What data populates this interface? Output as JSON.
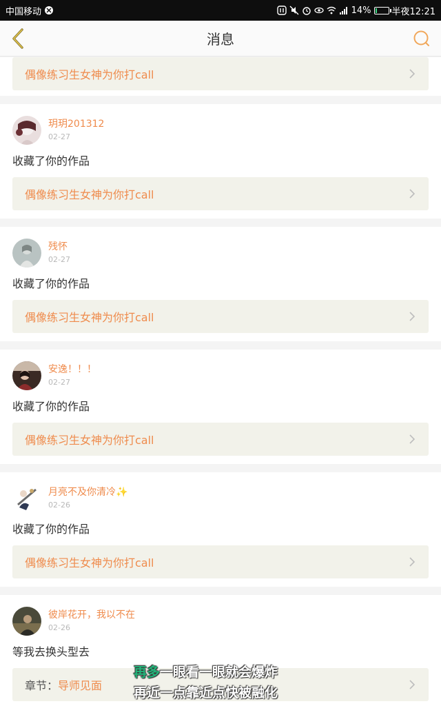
{
  "status_bar": {
    "carrier": "中国移动",
    "battery": "14%",
    "battery_level": 0.14,
    "time": "半夜12:21"
  },
  "header": {
    "title": "消息"
  },
  "top_card": {
    "work_title": "偶像练习生女神为你打call"
  },
  "messages": [
    {
      "username": "玥玥201312",
      "date": "02-27",
      "action": "收藏了你的作品",
      "work_title": "偶像练习生女神为你打call"
    },
    {
      "username": "残怀",
      "date": "02-27",
      "action": "收藏了你的作品",
      "work_title": "偶像练习生女神为你打call"
    },
    {
      "username": "安逸！！！",
      "date": "02-27",
      "action": "收藏了你的作品",
      "work_title": "偶像练习生女神为你打call"
    },
    {
      "username": "月亮不及你清冷✨",
      "date": "02-26",
      "action": "收藏了你的作品",
      "work_title": "偶像练习生女神为你打call"
    },
    {
      "username": "彼岸花开，我以不在",
      "date": "02-26",
      "action": "等我去换头型去",
      "chapter_label": "章节：",
      "chapter_name": "导师见面"
    }
  ],
  "subtitle": {
    "line1_highlight": "再多",
    "line1_rest": "一眼看一眼就会爆炸",
    "line2": "再近一点靠近点快被融化"
  },
  "colors": {
    "accent": "#ef8b4c",
    "box_bg": "#f2f2ea"
  }
}
